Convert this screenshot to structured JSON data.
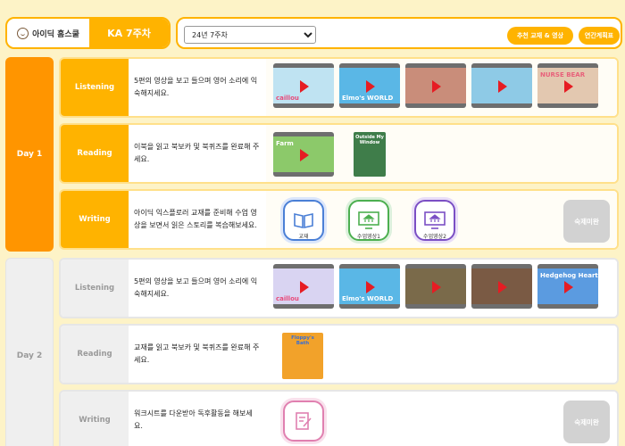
{
  "brand": {
    "name": "아이딕 홈스쿨",
    "week": "KA 7주차"
  },
  "toolbar": {
    "week_select": "24년 7주차",
    "recommend_button": "추천 교재 & 영상",
    "annual_button": "연간계획표"
  },
  "days": [
    {
      "label": "Day 1",
      "rows": [
        {
          "label": "Listening",
          "desc": "5편의 영상을 보고 들으며 영어 소리에 익숙해지세요.",
          "videos": [
            {
              "text": "caillou",
              "color": "#bfe3f2"
            },
            {
              "text": "Elmo's WORLD",
              "color": "#5ab7e6"
            },
            {
              "text": "",
              "color": "#c98d7a"
            },
            {
              "text": "",
              "color": "#8ecae6"
            },
            {
              "text": "NURSE BEAR",
              "color": "#e3c8b0"
            }
          ]
        },
        {
          "label": "Reading",
          "desc": "이북을 읽고 북보카 및 북퀴즈를 완료해 주세요.",
          "videos": [
            {
              "text": "Farm",
              "color": "#8cc96a"
            }
          ],
          "book": {
            "title": "Outside My Window",
            "color": "#3f7d4a"
          }
        },
        {
          "label": "Writing",
          "desc": "아이딕 익스플로러 교재를 준비해 수업 영상을 보면서 읽은 스토리를 복습해보세요.",
          "tools": [
            {
              "caption": "교재",
              "color": "#4a7fd6"
            },
            {
              "caption": "수업영상1",
              "color": "#4caf50"
            },
            {
              "caption": "수업영상2",
              "color": "#7b4fc4"
            }
          ],
          "status": "숙제미완"
        }
      ]
    },
    {
      "label": "Day 2",
      "rows": [
        {
          "label": "Listening",
          "desc": "5편의 영상을 보고 들으며 영어 소리에 익숙해지세요.",
          "videos": [
            {
              "text": "caillou",
              "color": "#d9d4f2"
            },
            {
              "text": "Elmo's WORLD",
              "color": "#5ab7e6"
            },
            {
              "text": "",
              "color": "#7a6a4a"
            },
            {
              "text": "",
              "color": "#7a5a44"
            },
            {
              "text": "Hedgehog Heart",
              "color": "#5b9be0"
            }
          ]
        },
        {
          "label": "Reading",
          "desc": "교재를 읽고 북보카 및 북퀴즈를 완료해 주세요.",
          "book": {
            "title": "Floppy's Bath",
            "color": "#f2a22a"
          }
        },
        {
          "label": "Writing",
          "desc": "워크시트를 다운받아 독후활동을 해보세요.",
          "tools": [
            {
              "caption": "",
              "color": "#e080b0"
            }
          ],
          "status": "숙제미완"
        }
      ]
    }
  ]
}
